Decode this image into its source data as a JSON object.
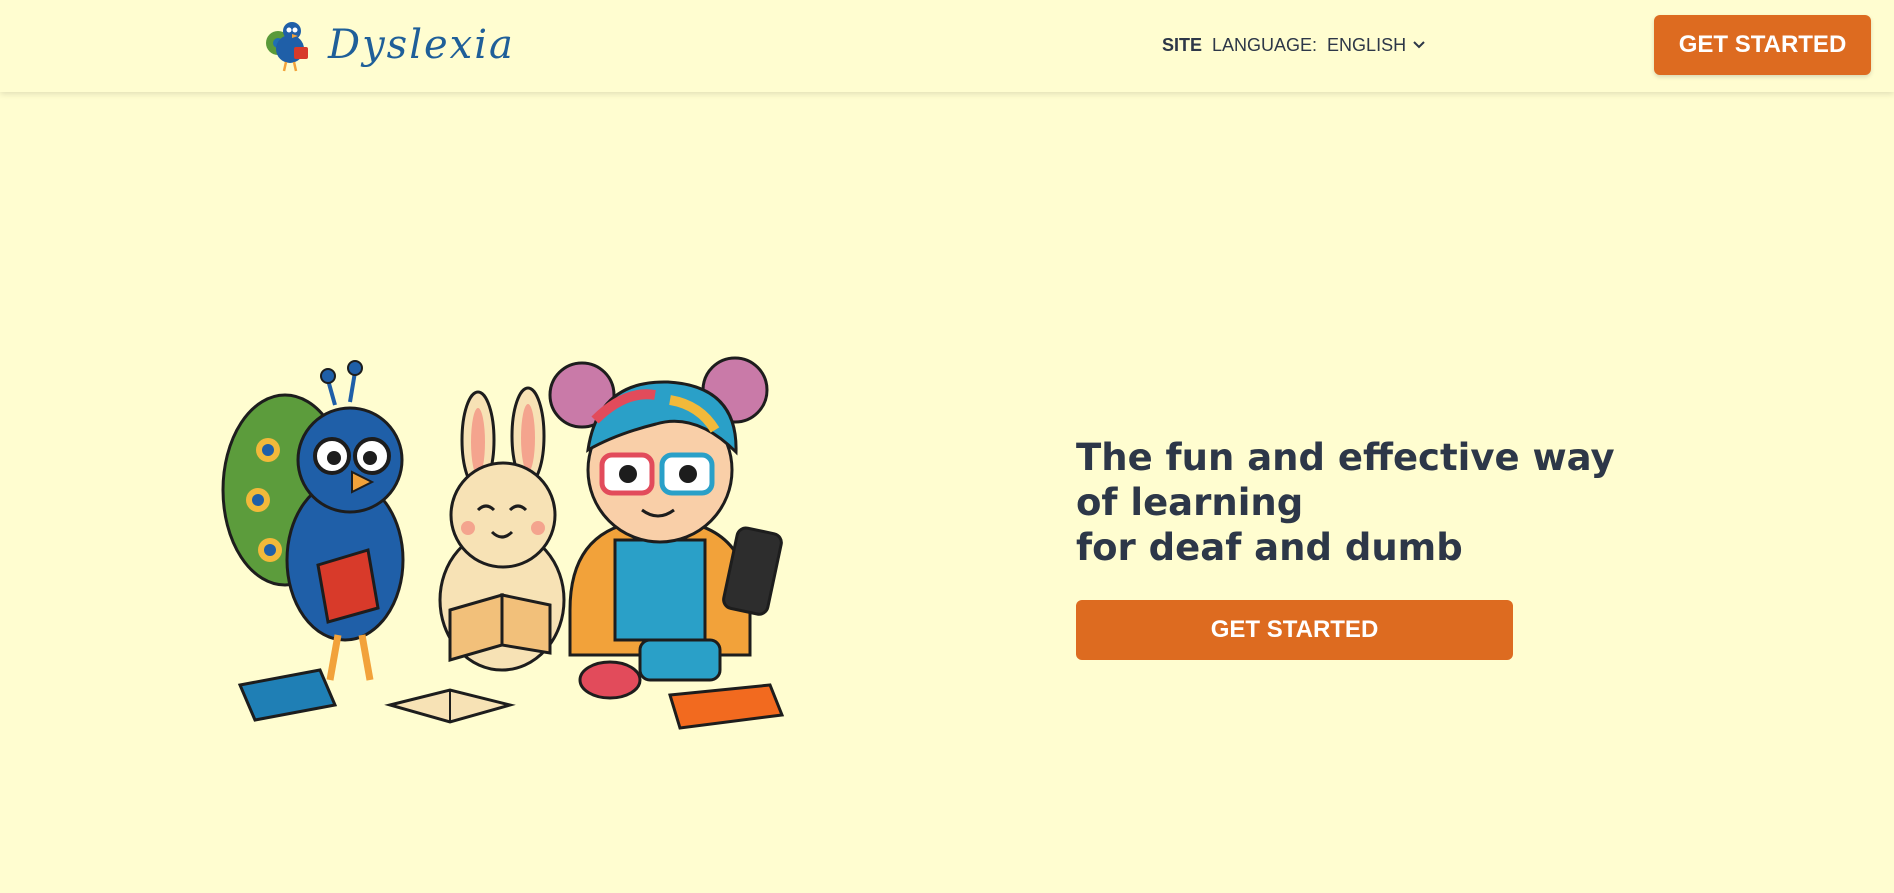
{
  "header": {
    "logo_text": "Dyslexia",
    "site_label": "SITE",
    "language_label": "LANGUAGE:",
    "language_value": "ENGLISH",
    "cta_label": "GET STARTED"
  },
  "hero": {
    "headline_line1": "The fun and effective way of learning",
    "headline_line2": "for deaf and dumb",
    "cta_label": "GET STARTED"
  },
  "colors": {
    "background": "#fffdd0",
    "accent": "#dd6b20",
    "text": "#2d3748",
    "logo": "#1f5f99"
  },
  "icons": [
    "peacock-logo-icon",
    "chevron-down-icon"
  ]
}
